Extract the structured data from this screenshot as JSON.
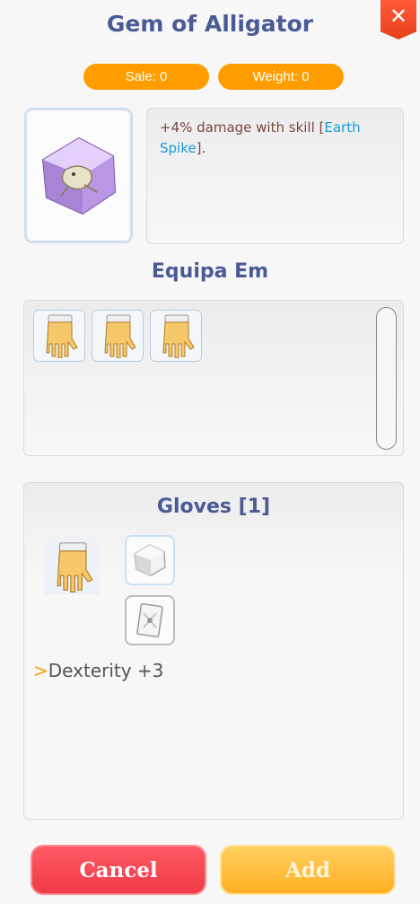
{
  "item": {
    "name": "Gem of Alligator",
    "sale": "Sale: 0",
    "weight": "Weight: 0",
    "description_prefix": "+4% damage with skill [",
    "description_skill": "Earth Spike",
    "description_suffix": "]."
  },
  "close_label": "✕",
  "equip_section": {
    "title": "Equipa Em",
    "slots": [
      "glove-icon",
      "glove-icon",
      "glove-icon"
    ]
  },
  "detail": {
    "title": "Gloves [1]",
    "bonus_arrow": ">",
    "bonus_text": "Dexterity +3"
  },
  "buttons": {
    "cancel": "Cancel",
    "add": "Add"
  },
  "colors": {
    "accent_orange": "#ff9d00",
    "title_blue": "#4a5a95",
    "skill_blue": "#1a9ad8",
    "cancel_red": "#f03a48",
    "add_yellow": "#ffae22"
  }
}
